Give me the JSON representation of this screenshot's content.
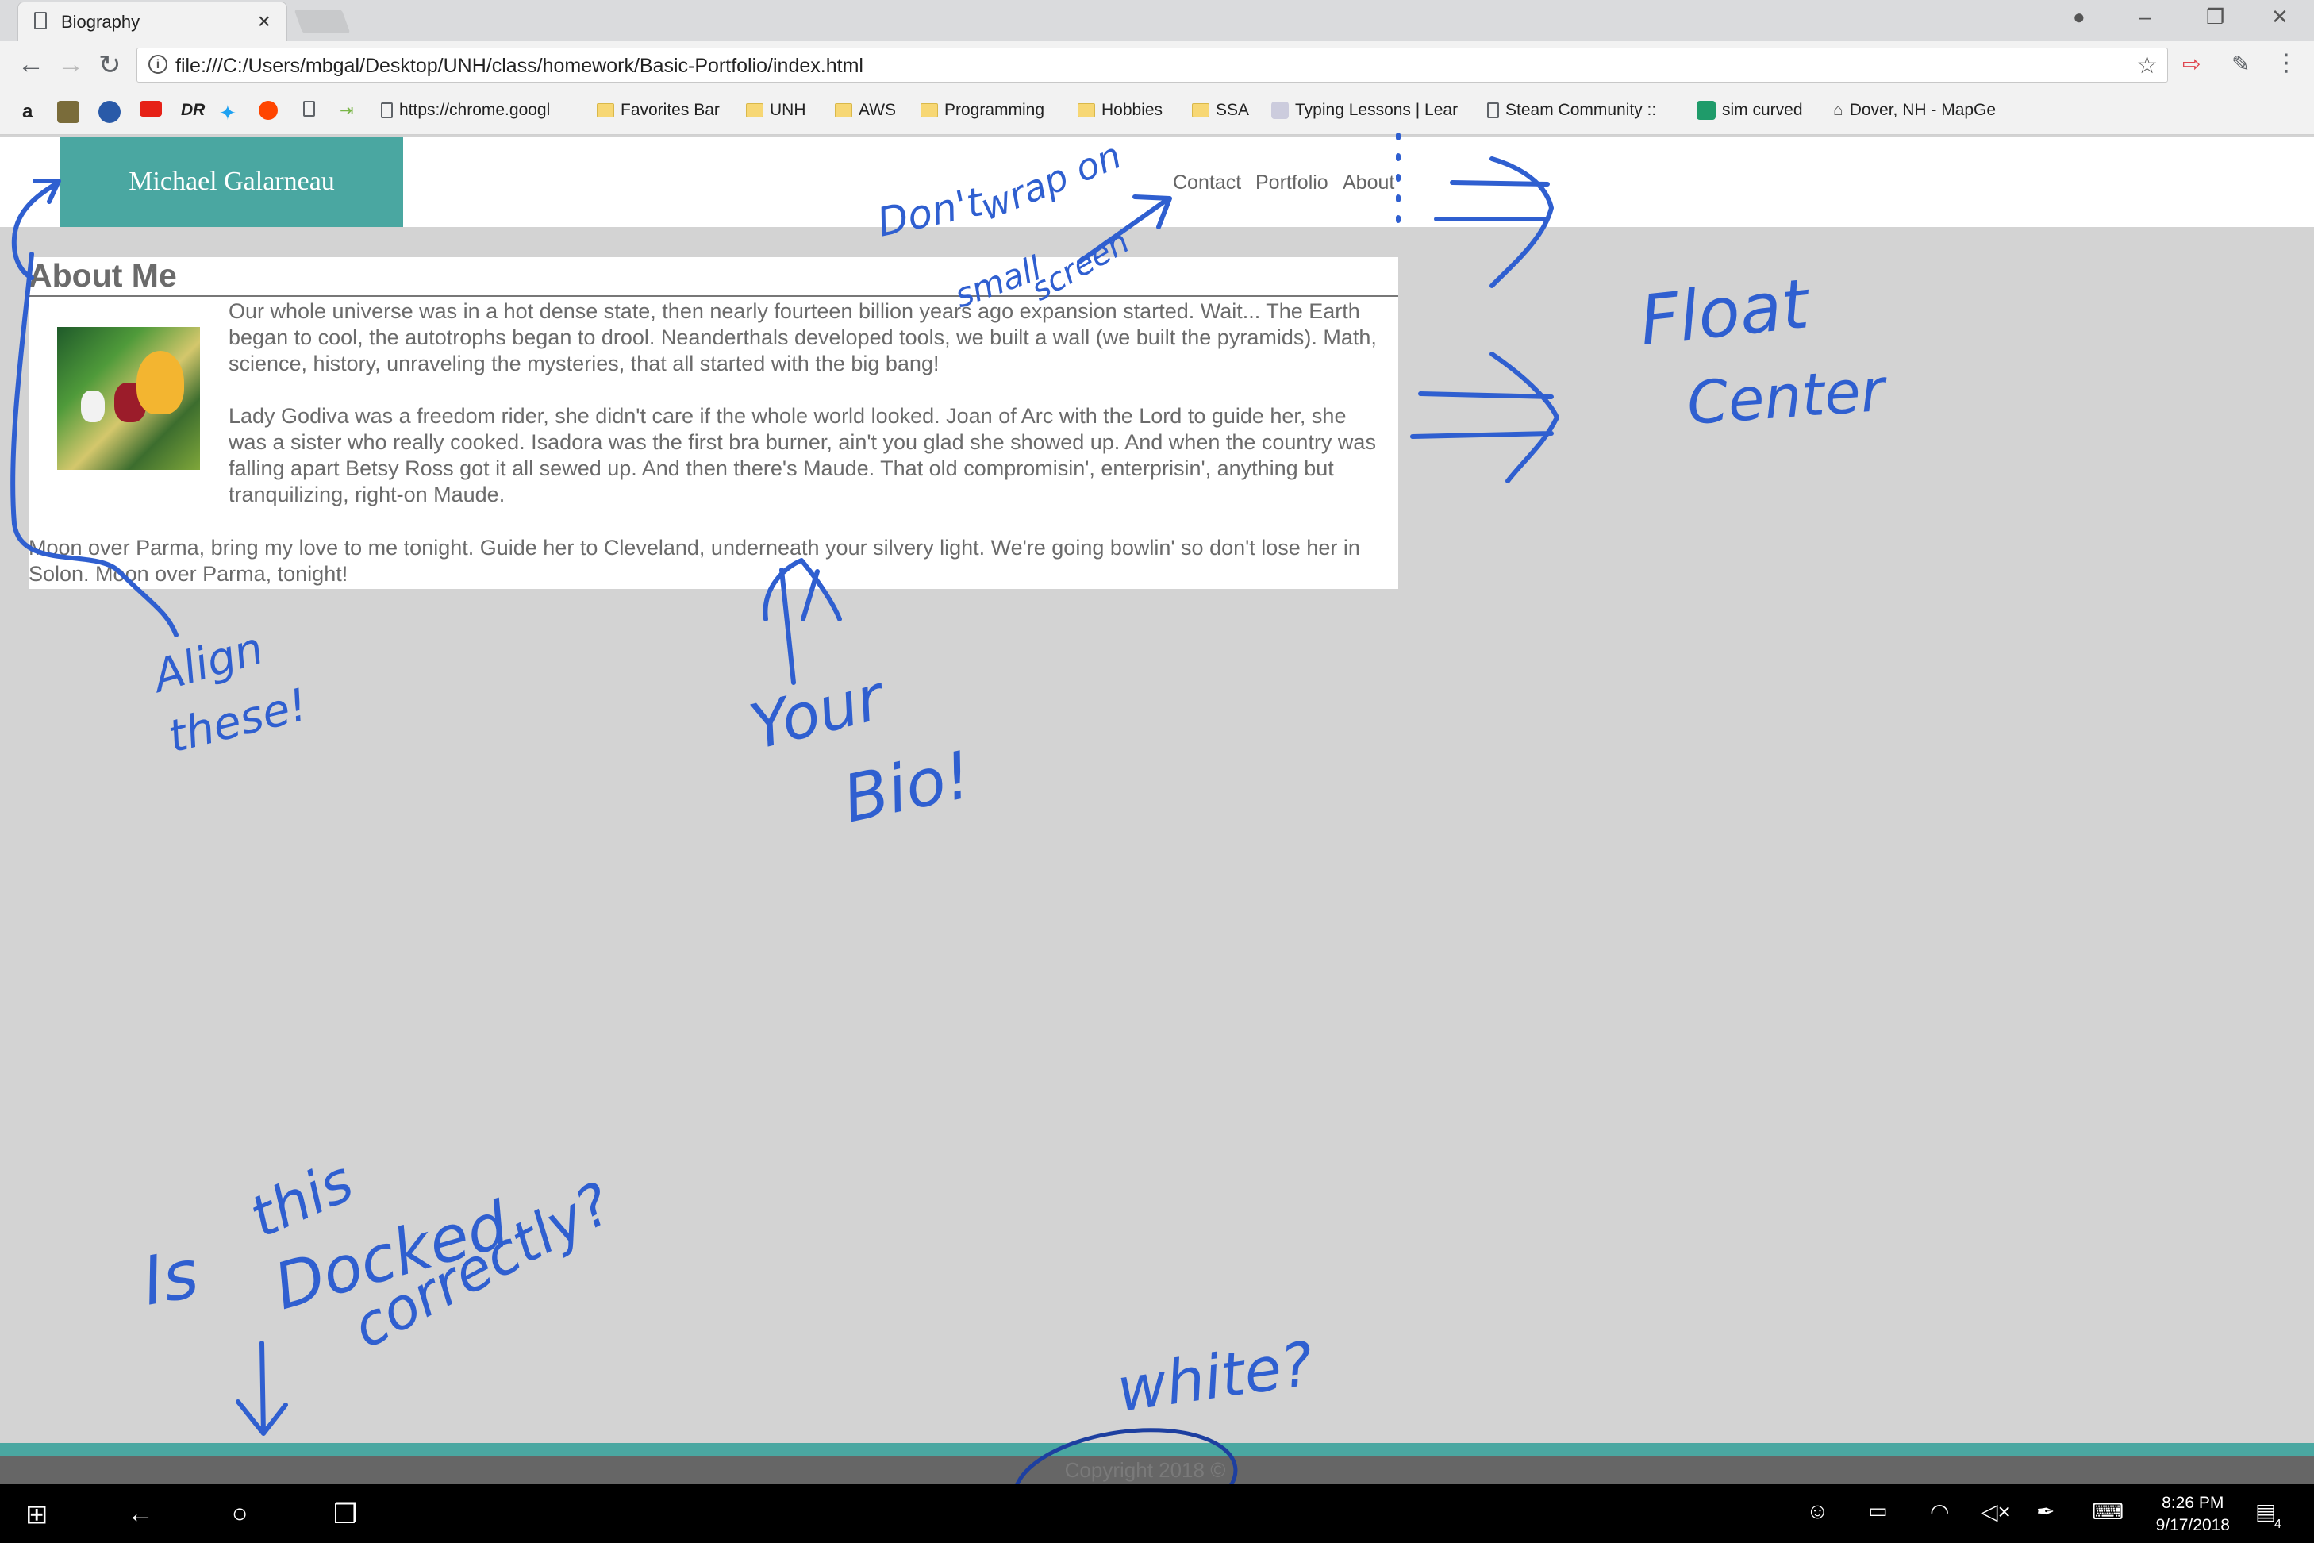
{
  "browser": {
    "tab_title": "Biography",
    "url": "file:///C:/Users/mbgal/Desktop/UNH/class/homework/Basic-Portfolio/index.html",
    "bookmarks": [
      {
        "label": "https://chrome.googl"
      },
      {
        "label": "Favorites Bar"
      },
      {
        "label": "UNH"
      },
      {
        "label": "AWS"
      },
      {
        "label": "Programming"
      },
      {
        "label": "Hobbies"
      },
      {
        "label": "SSA"
      },
      {
        "label": "Typing Lessons | Lear"
      },
      {
        "label": "Steam Community :: "
      },
      {
        "label": "sim curved"
      },
      {
        "label": "Dover, NH - MapGe"
      }
    ]
  },
  "site": {
    "brand": "Michael Galarneau",
    "nav": [
      "Contact",
      "Portfolio",
      "About"
    ],
    "about_title": "About Me",
    "para1": "Our whole universe was in a hot dense state, then nearly fourteen billion years ago expansion started. Wait... The Earth began to cool, the autotrophs began to drool. Neanderthals developed tools, we built a wall (we built the pyramids). Math, science, history, unraveling the mysteries, that all started with the big bang!",
    "para2": "Lady Godiva was a freedom rider, she didn't care if the whole world looked. Joan of Arc with the Lord to guide her, she was a sister who really cooked. Isadora was the first bra burner, ain't you glad she showed up. And when the country was falling apart Betsy Ross got it all sewed up. And then there's Maude. That old compromisin', enterprisin', anything but tranquilizing, right-on Maude.",
    "para3": "Moon over Parma, bring my love to me tonight. Guide her to Cleveland, underneath your silvery light. We're going bowlin' so don't lose her in Solon. Moon over Parma, tonight!",
    "footer": "Copyright 2018 ©"
  },
  "annotations": {
    "wrap": [
      "Don't",
      "wrap on",
      "small",
      "screen"
    ],
    "float": [
      "Float",
      "Center"
    ],
    "align": [
      "Align",
      "these!"
    ],
    "bio": [
      "Your",
      "Bio!"
    ],
    "docked": [
      "Is",
      "this",
      "Docked",
      "correctly?"
    ],
    "white": "white?"
  },
  "taskbar": {
    "time": "8:26 PM",
    "date": "9/17/2018",
    "notifications": "4"
  },
  "colors": {
    "accent": "#4aa7a1",
    "ink": "#2f5fd0",
    "page_bg": "#d3d3d3"
  }
}
